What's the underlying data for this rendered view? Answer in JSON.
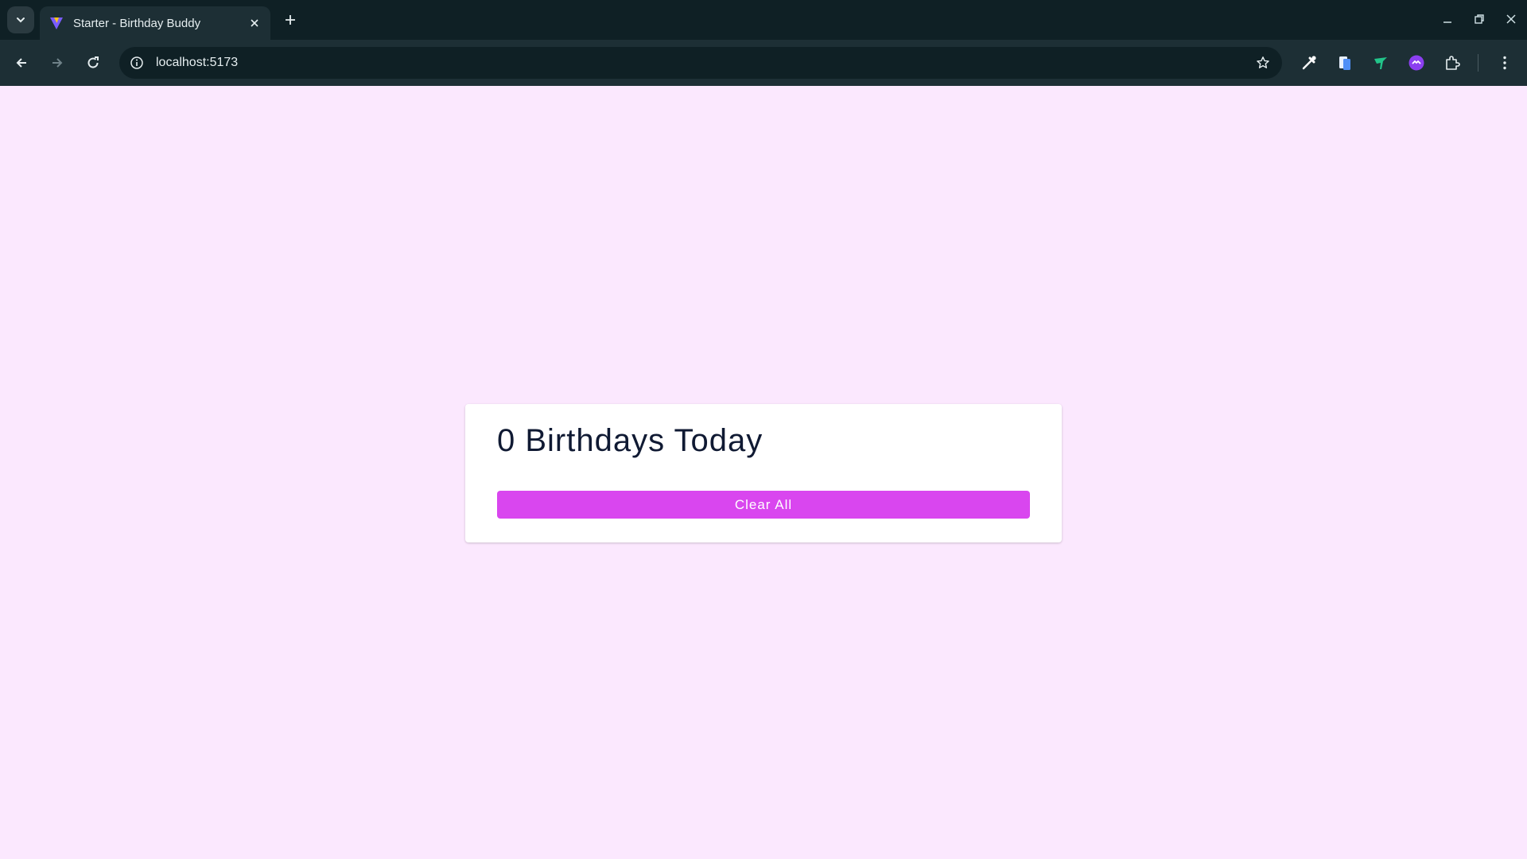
{
  "browser": {
    "tab_title": "Starter - Birthday Buddy",
    "url": "localhost:5173",
    "icons": {
      "tab_search": "chevron-down-icon",
      "tab_close": "close-icon",
      "new_tab": "plus-icon",
      "back": "arrow-left-icon",
      "forward": "arrow-right-icon",
      "reload": "reload-icon",
      "site_info": "info-icon",
      "bookmark": "star-icon",
      "extensions": [
        "eyedropper-icon",
        "docs-icon",
        "green-bird-icon",
        "purple-link-icon",
        "puzzle-icon"
      ],
      "menu": "kebab-menu-icon",
      "window": [
        "minimize-icon",
        "restore-icon",
        "window-close-icon"
      ]
    },
    "colors": {
      "chrome_dark": "#0f2025",
      "chrome_toolbar": "#1d2f35"
    }
  },
  "page": {
    "background": "#fbe8fe",
    "card": {
      "title": "0 Birthdays Today",
      "clear_button_label": "Clear All"
    },
    "colors": {
      "accent": "#d946ef",
      "title_text": "#101a33"
    }
  }
}
